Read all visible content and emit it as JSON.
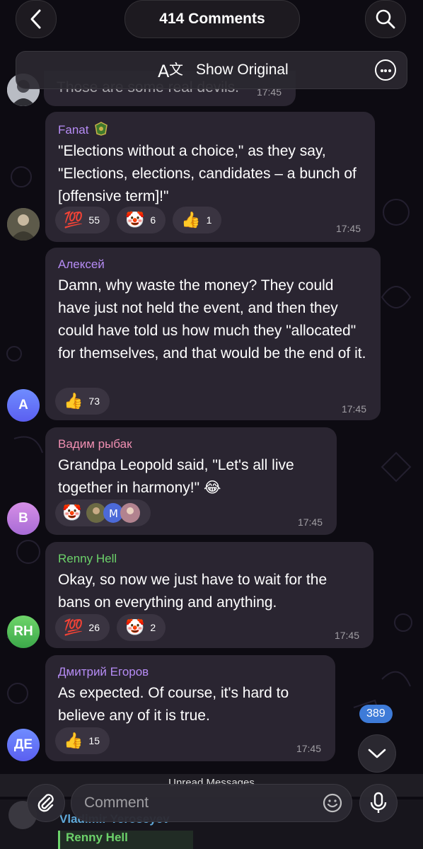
{
  "header": {
    "title": "414 Comments",
    "show_original": "Show Original"
  },
  "partial_message": {
    "text": "Those are some real devils.",
    "time": "17:45"
  },
  "messages": [
    {
      "author": "Fanat",
      "author_color": "#b68cf5",
      "text": "\"Elections without a choice,\" as they say, \"Elections, elections, candidates – a bunch of [offensive term]!\"",
      "time": "17:45",
      "reactions": [
        {
          "emoji": "💯",
          "count": "55"
        },
        {
          "emoji": "🤡",
          "count": "6"
        },
        {
          "emoji": "👍",
          "count": "1"
        }
      ]
    },
    {
      "author": "Алексей",
      "author_color": "#b68cf5",
      "text": "Damn, why waste the money? They could have just not held the event, and then they could have told us how much they \"allocated\" for themselves, and that would be the end of it.",
      "time": "17:45",
      "avatar": "A",
      "reactions": [
        {
          "emoji": "👍",
          "count": "73"
        }
      ]
    },
    {
      "author": "Вадим рыбак",
      "author_color": "#f08fb2",
      "text": "Grandpa Leopold said, \"Let's all live together in harmony!\" 😂",
      "time": "17:45",
      "avatar": "B",
      "reactions": [
        {
          "emoji": "🤡",
          "count": ""
        }
      ]
    },
    {
      "author": "Renny Hell",
      "author_color": "#6cd26a",
      "text": "Okay, so now we just have to wait for the bans on everything and anything.",
      "time": "17:45",
      "avatar": "RH",
      "reactions": [
        {
          "emoji": "💯",
          "count": "26"
        },
        {
          "emoji": "🤡",
          "count": "2"
        }
      ]
    },
    {
      "author": "Дмитрий Егоров",
      "author_color": "#b68cf5",
      "text": "As expected. Of course, it's hard to believe any of it is true.",
      "time": "17:45",
      "avatar": "ДЕ",
      "reactions": [
        {
          "emoji": "👍",
          "count": "15"
        }
      ]
    }
  ],
  "unread_label": "Unread Messages",
  "composer": {
    "placeholder": "Comment"
  },
  "scroll_badge": "389",
  "peek": {
    "author": "Vladimir Yeroseyev",
    "quote_author": "Renny Hell"
  }
}
